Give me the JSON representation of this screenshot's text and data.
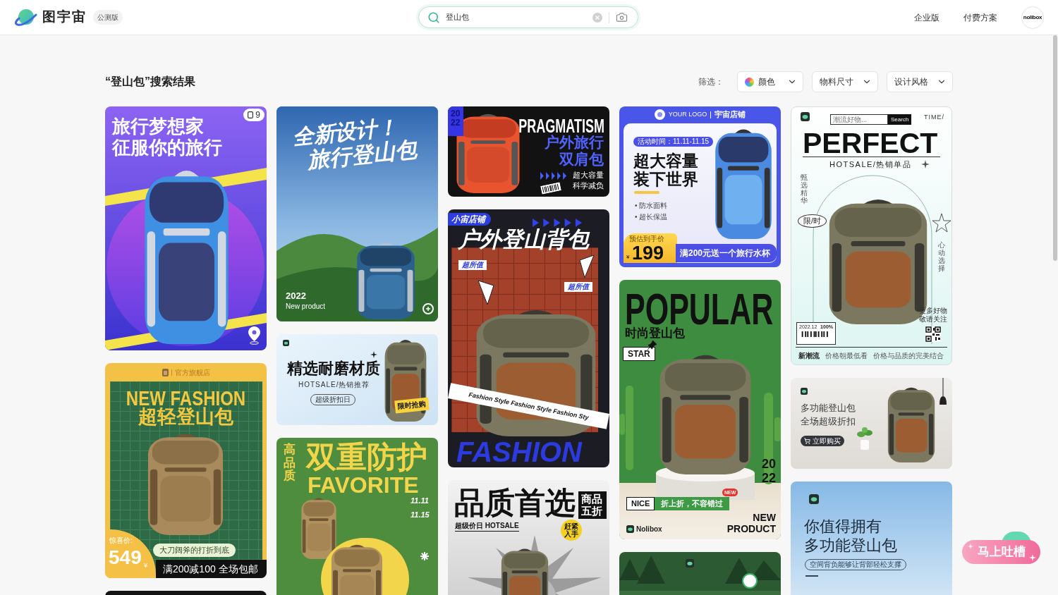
{
  "header": {
    "logo_text": "图宇宙",
    "badge": "公测版",
    "search": {
      "value": "登山包"
    },
    "nav": [
      {
        "label": "企业版"
      },
      {
        "label": "付费方案"
      }
    ],
    "avatar": "nolibox"
  },
  "results": {
    "title": "“登山包”搜索结果",
    "filter_label": "筛选：",
    "filters": [
      {
        "label": "颜色",
        "kind": "color"
      },
      {
        "label": "物料尺寸",
        "kind": "plain"
      },
      {
        "label": "设计风格",
        "kind": "plain"
      }
    ]
  },
  "columns": [
    [
      {
        "kind": "dreamer",
        "pages": "9",
        "lines": [
          "旅行梦想家",
          "征服你的旅行"
        ]
      },
      {
        "kind": "fashion",
        "store": "官方旗舰店",
        "title": "NEW FASHION",
        "subtitle": "超轻登山包",
        "price_label": "惊喜价:",
        "price": "549",
        "currency": "¥",
        "slogan": "大刀阔斧的打折到底",
        "offer": "满200减100 全场包邮"
      },
      {
        "kind": "dark"
      }
    ],
    [
      {
        "kind": "hiker",
        "lines": [
          "全新设计！",
          "旅行登山包"
        ],
        "year": "2022",
        "caption": "New product"
      },
      {
        "kind": "material",
        "title": "精选耐磨材质",
        "subtitle": "HOTSALE/热销推荐",
        "tag": "超级折扣日",
        "badge": "限时抢购"
      },
      {
        "kind": "favorite",
        "side": "高品质",
        "title": "双重防护",
        "subtitle": "FAVORITE",
        "dates": [
          "11.11",
          "11.15"
        ]
      }
    ],
    [
      {
        "kind": "pragmatism",
        "year": "2022",
        "title": "PRAGMATISM",
        "lines": [
          "户外旅行",
          "双肩包"
        ],
        "notes": [
          "超大容量",
          "科学减负"
        ]
      },
      {
        "kind": "outdoor",
        "shop": "小宙店铺",
        "title": "户外登山背包",
        "tags": [
          "超所值",
          "超所值"
        ],
        "banner": "Fashion Style Fashion Style Fashion Sty",
        "footer": "FASHION"
      },
      {
        "kind": "quality",
        "title": "品质首选",
        "badge": "商品五折",
        "hotsale": "超级价日 HOTSALE",
        "sticker": "赶紧入手"
      }
    ],
    [
      {
        "kind": "capacity",
        "logo": "YOUR LOGO",
        "shop": "宇宙店铺",
        "date": "活动时间：11.11-11.15",
        "lines": [
          "超大容量",
          "装下世界"
        ],
        "features": [
          "• 防水面料",
          "• 超长保温"
        ],
        "price_label": "预估到手价",
        "currency": "¥",
        "price": "199",
        "gift": "满200元送一个旅行水杯"
      },
      {
        "kind": "popular",
        "title": "POPULAR",
        "subtitle": "时尚登山包",
        "tag": "STAR",
        "year": "2022",
        "badge": "NEW",
        "label": "NICE",
        "deal": "折上折，不容错过",
        "footer": [
          "NEW",
          "PRODUCT"
        ],
        "brand": "Nolibox"
      },
      {
        "kind": "forest"
      }
    ],
    [
      {
        "kind": "perfect",
        "search": {
          "placeholder": "潮流好物...",
          "button": "Search"
        },
        "time": "TIME/",
        "title": "PERFECT",
        "subtitle": "HOTSALE/热销单品",
        "left_column": "甄选精华",
        "stamp": "限/时",
        "right_column": "心动选择",
        "date": "2022.12",
        "percent": "100%",
        "notes": [
          "更多好物",
          "敬请关注"
        ],
        "footer": [
          "新潮流",
          "价格朝最低看",
          "价格与品质的完美结合"
        ]
      },
      {
        "kind": "multi",
        "lines": [
          "多功能登山包",
          "全场超级折扣"
        ],
        "button": "立即购买"
      },
      {
        "kind": "worth",
        "lines": [
          "你值得拥有",
          "多功能登山包"
        ],
        "tag": "空间背负能够让背部轻松支撑"
      }
    ]
  ],
  "feedback": {
    "label": "马上吐槽"
  }
}
